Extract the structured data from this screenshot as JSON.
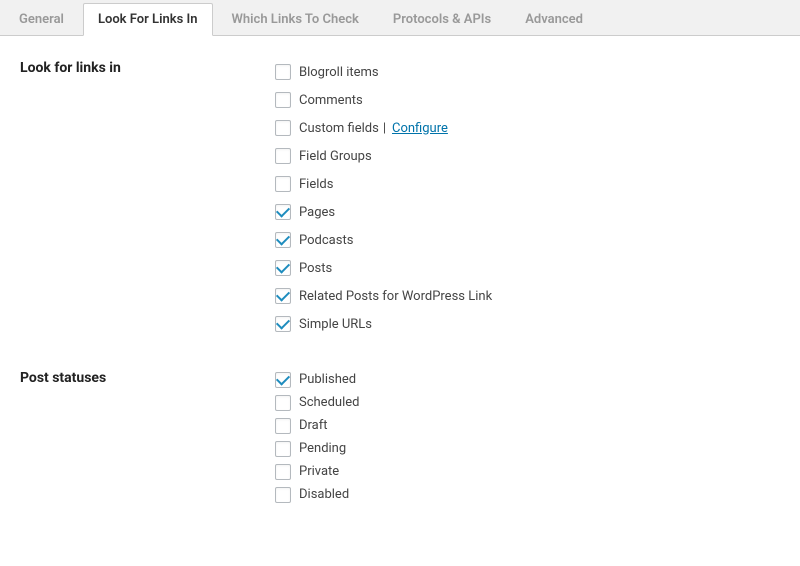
{
  "tabs": [
    {
      "label": "General",
      "active": false
    },
    {
      "label": "Look For Links In",
      "active": true
    },
    {
      "label": "Which Links To Check",
      "active": false
    },
    {
      "label": "Protocols & APIs",
      "active": false
    },
    {
      "label": "Advanced",
      "active": false
    }
  ],
  "sections": {
    "look_for_links": {
      "title": "Look for links in",
      "options": [
        {
          "label": "Blogroll items",
          "checked": false
        },
        {
          "label": "Comments",
          "checked": false
        },
        {
          "label": "Custom fields",
          "checked": false,
          "configure": "Configure"
        },
        {
          "label": "Field Groups",
          "checked": false
        },
        {
          "label": "Fields",
          "checked": false
        },
        {
          "label": "Pages",
          "checked": true
        },
        {
          "label": "Podcasts",
          "checked": true
        },
        {
          "label": "Posts",
          "checked": true
        },
        {
          "label": "Related Posts for WordPress Link",
          "checked": true
        },
        {
          "label": "Simple URLs",
          "checked": true
        }
      ]
    },
    "post_statuses": {
      "title": "Post statuses",
      "options": [
        {
          "label": "Published",
          "checked": true
        },
        {
          "label": "Scheduled",
          "checked": false
        },
        {
          "label": "Draft",
          "checked": false
        },
        {
          "label": "Pending",
          "checked": false
        },
        {
          "label": "Private",
          "checked": false
        },
        {
          "label": "Disabled",
          "checked": false
        }
      ]
    }
  },
  "separator": "|"
}
